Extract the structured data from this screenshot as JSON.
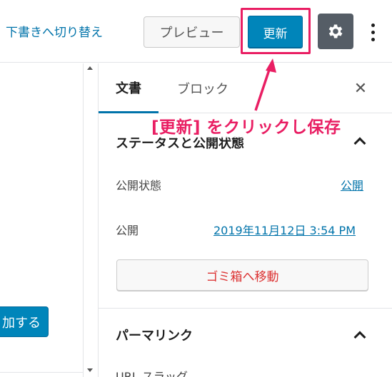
{
  "toolbar": {
    "switch_to_draft": "下書きへ切り替え",
    "preview": "プレビュー",
    "update": "更新",
    "settings_icon": "gear-icon",
    "more_icon": "vertical-ellipsis-icon"
  },
  "editor": {
    "add_button": "加する"
  },
  "sidebar": {
    "tabs": [
      "文書",
      "ブロック"
    ],
    "active_tab": "文書",
    "close_icon": "close-icon",
    "status_panel": {
      "title": "ステータスと公開状態",
      "visibility_label": "公開状態",
      "visibility_value": "公開",
      "publish_label": "公開",
      "publish_value": "2019年11月12日 3:54 PM",
      "trash_button": "ゴミ箱へ移動"
    },
    "permalink_panel": {
      "title": "パーマリンク",
      "url_slug_label": "URL スラッグ"
    }
  },
  "annotation": {
    "text": "[更新] をクリックし保存",
    "color": "#e91e63"
  },
  "colors": {
    "primary_blue": "#0085ba",
    "link_blue": "#0073aa",
    "trash_red": "#dc3232",
    "settings_dark": "#555d66"
  }
}
